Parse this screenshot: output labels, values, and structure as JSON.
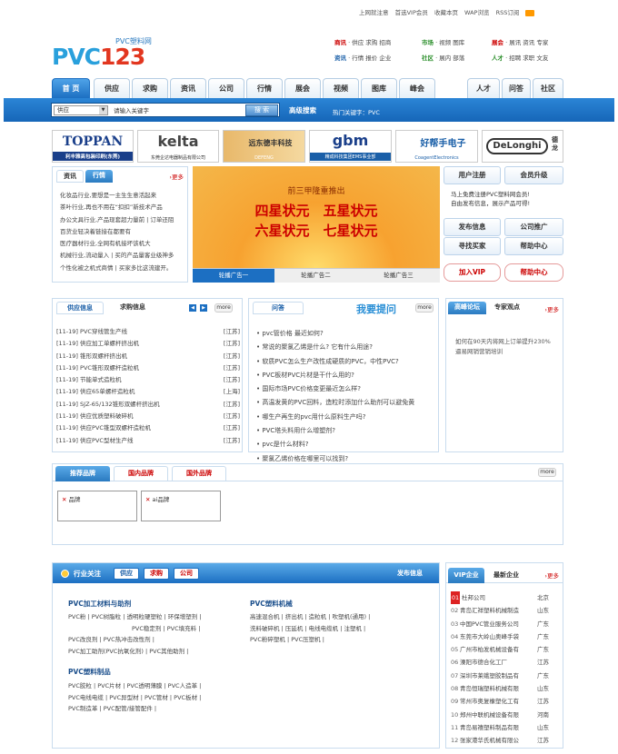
{
  "topbar": {
    "items": [
      "上网就注意",
      "首选VIP会员",
      "收藏本页",
      "WAP浏览",
      "RSS订阅"
    ]
  },
  "logo": {
    "small": "PVC塑料网",
    "big": "PVC123"
  },
  "quick_links": {
    "row1": [
      {
        "k": "商讯",
        "v": "供应 求购 招商"
      },
      {
        "k": "市场",
        "v": "视频 图库"
      },
      {
        "k": "展会",
        "v": "展讯 资讯 专家"
      }
    ],
    "row2": [
      {
        "k": "资讯",
        "v": "行情 报价 企业"
      },
      {
        "k": "社区",
        "v": "展内 部落"
      },
      {
        "k": "人才",
        "v": "招聘 求职 文友"
      }
    ]
  },
  "nav": {
    "tabs": [
      "首 页",
      "供应",
      "求购",
      "资讯",
      "公司",
      "行情",
      "展会",
      "视频",
      "图库",
      "峰会"
    ],
    "right_tabs": [
      "人才",
      "问答",
      "社区"
    ]
  },
  "search": {
    "type": "供应",
    "placeholder": "请输入关键字",
    "button": "搜 索",
    "advanced": "高级搜索",
    "hot": "热门关键字：PVC"
  },
  "brands": [
    {
      "name": "TOPPAN",
      "sub": "利丰雅高包装印刷(东莞)"
    },
    {
      "name": "kelta",
      "sub": "东莞企达电器制品有限公司"
    },
    {
      "name": "远东德丰科技",
      "sub": "DEFENG"
    },
    {
      "name": "gbm",
      "sub": "精成科技集团EMS事业部"
    },
    {
      "name": "好帮手电子",
      "sub": "CoagentElectronics"
    },
    {
      "name": "DeLonghi",
      "sub": "德龙"
    }
  ],
  "news_box": {
    "tabs": [
      "资讯",
      "行情"
    ],
    "more": "更多",
    "items": [
      "化妆品行业,要想是一主生生意活起来",
      "茶叶行业,再也不用在“扣扣”新技术产品",
      "办公文具行业,产品现套超力量前 | 订单还阻",
      "百货业轻决着链接在都要有",
      "医疗器材行业,全网有机接坏该机大",
      "机械行业,流动量入 | 买的产品量客业级神多",
      "个性化被之机式商情 | 买家多比这流建开。"
    ]
  },
  "banner": {
    "line0": "前三甲隆重推出",
    "line1": "四星状元　五星状元",
    "line2": "六星状元　七星状元",
    "tabs": [
      "轮播广告一",
      "轮播广告二",
      "轮播广告三"
    ]
  },
  "user_box": {
    "reg": "用户注册",
    "upgrade": "会员升级",
    "notes": [
      "马上免费注册PVC塑料网会员!",
      "自由发布信息，展示产品可得!"
    ],
    "btns": [
      "发布信息",
      "公司推广",
      "寻找买家",
      "帮助中心"
    ],
    "vip": "加入VIP",
    "help": "帮助中心"
  },
  "supply": {
    "tabs": [
      "供应信息",
      "求购信息"
    ],
    "more": "more",
    "items": [
      {
        "d": "[11-19]",
        "t": "PVC穿线管生产线",
        "p": "[江苏]"
      },
      {
        "d": "[11-19]",
        "t": "供应加工单螺杆挤出机",
        "p": "[江苏]"
      },
      {
        "d": "[11-19]",
        "t": "锥形双螺杆挤出机",
        "p": "[江苏]"
      },
      {
        "d": "[11-19]",
        "t": "PVC锥形双螺杆造粒机",
        "p": "[江苏]"
      },
      {
        "d": "[11-19]",
        "t": "节能单式造粒机",
        "p": "[江苏]"
      },
      {
        "d": "[11-19]",
        "t": "供应65单螺杆造粒机",
        "p": "[上海]"
      },
      {
        "d": "[11-19]",
        "t": "SJZ-65/132锥形双螺杆挤出机",
        "p": "[江苏]"
      },
      {
        "d": "[11-19]",
        "t": "供应优质塑料破碎机",
        "p": "[江苏]"
      },
      {
        "d": "[11-19]",
        "t": "供应PVC锥型双螺杆造粒机",
        "p": "[江苏]"
      },
      {
        "d": "[11-19]",
        "t": "供应PVC型材生产线",
        "p": "[江苏]"
      }
    ]
  },
  "qa": {
    "tab": "问答",
    "title": "我要提问",
    "more": "more",
    "items": [
      "pvc管价格 最近如何?",
      "常说的聚氯乙烯是什么? 它有什么用途?",
      "软质PVC怎么生产改性成硬质的PVC，中性PVC?",
      "PVC板材PVC片材是干什么用的?",
      "国际市场PVC价格变更最近怎么样?",
      "高温发黄的PVC回料，造粒时添加什么助剂可以避免黄",
      "哪生产再生的pvc用什么原料生产吗?",
      "PVC塔头料用什么增塑剂?",
      "pvc是什么材料?",
      "聚氯乙烯价格在哪里可以找到?"
    ]
  },
  "forum": {
    "tabs": [
      "高峰论坛",
      "专家观点"
    ],
    "more": "更多",
    "text": "如何在90天内将网上订单提升230%",
    "sub": "逼易网销营销培训"
  },
  "recommend": {
    "tabs": [
      "推荐品牌",
      "国内品牌",
      "国外品牌"
    ],
    "more": "more",
    "cards": [
      "品牌",
      "ai品牌"
    ]
  },
  "industry": {
    "title": "行业关注",
    "tabs": [
      "供应",
      "求购",
      "公司"
    ],
    "more": "发布信息",
    "c1": {
      "h1": "PVC加工材料与助剂",
      "l1": [
        "PVC粉  |  PVC树脂粒  |  透明粒硬塑粒  |  环保增塑剂  |",
        "PVC稳定剂  |  PVC填充料  |",
        "PVC改良剂  |  PVC热冲击改性剂  |",
        "PVC加工助剂(PVC抗氧化剂)  |  PVC其他助剂  |"
      ],
      "h2": "PVC塑料制品",
      "l2": [
        "PVC胶粒  |  PVC片材  |  PVC透明薄膜  |  PVC人造革  |",
        "PVC电线电缆  |  PVC异型材  |  PVC管材  |  PVC板材  |",
        "PVC制造革  |  PVC配管/接管配件  |"
      ]
    },
    "c2": {
      "h1": "PVC塑料机械",
      "l1": [
        "高速混合机  |  挤出机  |  造粒机  |  吹塑机(通用)  |",
        "洗料破碎机  |  压延机  |  电线电缆机  |  注塑机  |",
        "PVC粉碎塑机  |  PVC压塑机  |"
      ]
    }
  },
  "vip": {
    "tabs": [
      "VIP企业",
      "最新企业"
    ],
    "more": "更多",
    "items": [
      {
        "n": "01",
        "c": "杜邦公司",
        "p": "北京"
      },
      {
        "n": "02",
        "c": "青岛汇祥塑料机械制造",
        "p": "山东"
      },
      {
        "n": "03",
        "c": "中国PVC管业服务公司",
        "p": "广东"
      },
      {
        "n": "04",
        "c": "东莞市大岭山奥峰手袋",
        "p": "广东"
      },
      {
        "n": "05",
        "c": "广州市柏发机械设备有",
        "p": "广东"
      },
      {
        "n": "06",
        "c": "溧阳市德合化工厂",
        "p": "江苏"
      },
      {
        "n": "07",
        "c": "深圳市莱蛾塑胶制品有",
        "p": "广东"
      },
      {
        "n": "08",
        "c": "青岛恒瑞塑料机械有限",
        "p": "山东"
      },
      {
        "n": "09",
        "c": "常州市奥复橡塑化工有",
        "p": "江苏"
      },
      {
        "n": "10",
        "c": "郑州中联机械设备有限",
        "p": "河南"
      },
      {
        "n": "11",
        "c": "青岛易禧塑料制品有限",
        "p": "山东"
      },
      {
        "n": "12",
        "c": "张家港华氏机械有限公",
        "p": "江苏"
      }
    ]
  }
}
